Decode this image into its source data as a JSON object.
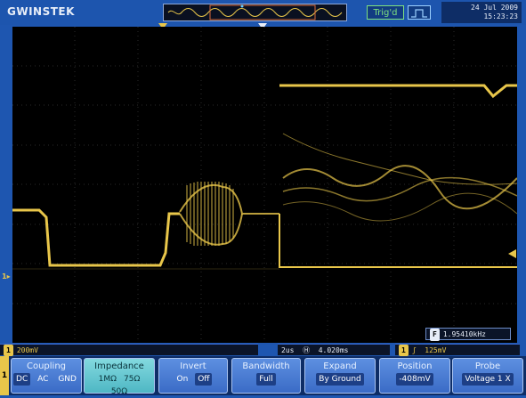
{
  "header": {
    "brand": "GWINSTEK",
    "trigger_state": "Trig'd",
    "date": "24 Jul 2009",
    "time": "15:23:23"
  },
  "waveform": {
    "color": "#e8c64a",
    "ground_marker": "1"
  },
  "readouts": {
    "ch1_scale": "200mV",
    "timebase": "2us",
    "delay": "4.020ms",
    "trigger_level": "125mV",
    "frequency": "1.95410kHz"
  },
  "menu": {
    "channel_tab": "1",
    "softkeys": [
      {
        "id": "coupling",
        "title": "Coupling",
        "options": [
          "DC",
          "AC",
          "GND"
        ],
        "selected": "DC"
      },
      {
        "id": "impedance",
        "title": "Impedance",
        "options": [
          "1MΩ",
          "75Ω",
          "50Ω"
        ],
        "selected": "1MΩ"
      },
      {
        "id": "invert",
        "title": "Invert",
        "options": [
          "On",
          "Off"
        ],
        "selected": "Off"
      },
      {
        "id": "bandwidth",
        "title": "Bandwidth",
        "value": "Full"
      },
      {
        "id": "expand",
        "title": "Expand",
        "value": "By Ground"
      },
      {
        "id": "position",
        "title": "Position",
        "value": "-408mV"
      },
      {
        "id": "probe",
        "title": "Probe",
        "value": "Voltage  1 X"
      }
    ]
  },
  "icons": {
    "trigger_type": "rising-edge-pulse-icon",
    "ch_marker": "ground-arrow-icon"
  }
}
